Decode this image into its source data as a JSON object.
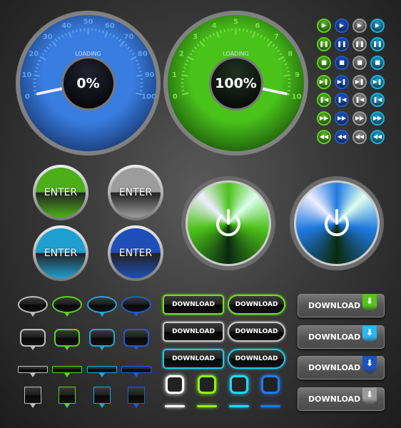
{
  "gauges": [
    {
      "label": "LOADING",
      "value_text": "0%",
      "value": 0,
      "scale": [
        "0",
        "10",
        "20",
        "30",
        "40",
        "50",
        "60",
        "70",
        "80",
        "90",
        "100"
      ],
      "color": "#3a7de0",
      "tick_color": "#5fa0f0"
    },
    {
      "label": "LOADING",
      "value_text": "100%",
      "value": 100,
      "scale": [
        "0",
        "1",
        "2",
        "3",
        "4",
        "5",
        "6",
        "7",
        "8",
        "9",
        "10"
      ],
      "color": "#49c21a",
      "tick_color": "#7be04a"
    }
  ],
  "media_buttons": {
    "colors": [
      "#5fcf1f",
      "#1d5ad0",
      "#9a9a9a",
      "#1ab0e0"
    ],
    "icons": [
      {
        "name": "play-icon",
        "glyph": "▶"
      },
      {
        "name": "pause-icon",
        "glyph": "❚❚"
      },
      {
        "name": "stop-icon",
        "glyph": "■"
      },
      {
        "name": "skip-next-icon",
        "glyph": "▶❚"
      },
      {
        "name": "skip-previous-icon",
        "glyph": "❚◀"
      },
      {
        "name": "fast-forward-icon",
        "glyph": "▶▶"
      },
      {
        "name": "rewind-icon",
        "glyph": "◀◀"
      }
    ]
  },
  "enter_buttons": [
    {
      "label": "ENTER",
      "color": "#4caf1a"
    },
    {
      "label": "ENTER",
      "color": "#9c9c9c"
    },
    {
      "label": "ENTER",
      "color": "#1e9fd0"
    },
    {
      "label": "ENTER",
      "color": "#1e4fb8"
    }
  ],
  "power_buttons": [
    {
      "icon": "power-icon",
      "color": "#4cc21a"
    },
    {
      "icon": "power-icon",
      "color": "#1f7ae0"
    }
  ],
  "bubble_colors": [
    "#bdbdbd",
    "#5fd01f",
    "#1fa8d8",
    "#1f5ad8"
  ],
  "download": {
    "label": "DOWNLOAD",
    "outline_colors": [
      "#6fe01f",
      "#c8c8c8",
      "#1fc8e8"
    ],
    "ribbon_colors": [
      "#55c51a",
      "#2bb8f0",
      "#1e52c0",
      "#9a9a9a"
    ],
    "arrow_icon": "download-arrow-icon"
  },
  "glow_colors": [
    "#ffffff",
    "#8ff01f",
    "#1fd8ff",
    "#1f7af0"
  ]
}
